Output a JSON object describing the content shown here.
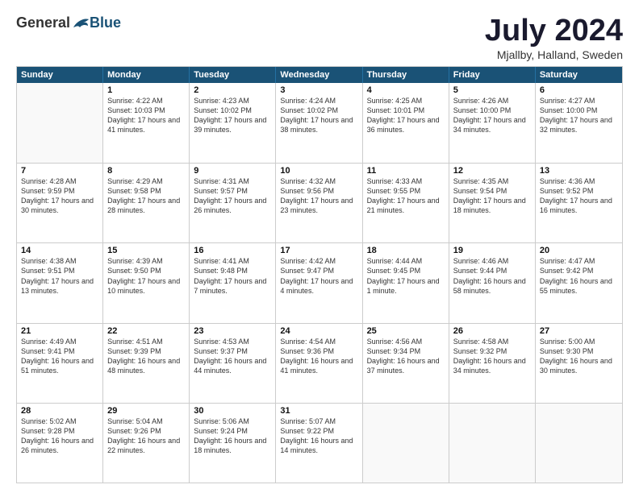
{
  "header": {
    "logo_general": "General",
    "logo_blue": "Blue",
    "month_title": "July 2024",
    "location": "Mjallby, Halland, Sweden"
  },
  "days_of_week": [
    "Sunday",
    "Monday",
    "Tuesday",
    "Wednesday",
    "Thursday",
    "Friday",
    "Saturday"
  ],
  "weeks": [
    [
      {
        "day": "",
        "empty": true
      },
      {
        "day": "1",
        "sunrise": "4:22 AM",
        "sunset": "10:03 PM",
        "daylight": "17 hours and 41 minutes."
      },
      {
        "day": "2",
        "sunrise": "4:23 AM",
        "sunset": "10:02 PM",
        "daylight": "17 hours and 39 minutes."
      },
      {
        "day": "3",
        "sunrise": "4:24 AM",
        "sunset": "10:02 PM",
        "daylight": "17 hours and 38 minutes."
      },
      {
        "day": "4",
        "sunrise": "4:25 AM",
        "sunset": "10:01 PM",
        "daylight": "17 hours and 36 minutes."
      },
      {
        "day": "5",
        "sunrise": "4:26 AM",
        "sunset": "10:00 PM",
        "daylight": "17 hours and 34 minutes."
      },
      {
        "day": "6",
        "sunrise": "4:27 AM",
        "sunset": "10:00 PM",
        "daylight": "17 hours and 32 minutes."
      }
    ],
    [
      {
        "day": "7",
        "sunrise": "4:28 AM",
        "sunset": "9:59 PM",
        "daylight": "17 hours and 30 minutes."
      },
      {
        "day": "8",
        "sunrise": "4:29 AM",
        "sunset": "9:58 PM",
        "daylight": "17 hours and 28 minutes."
      },
      {
        "day": "9",
        "sunrise": "4:31 AM",
        "sunset": "9:57 PM",
        "daylight": "17 hours and 26 minutes."
      },
      {
        "day": "10",
        "sunrise": "4:32 AM",
        "sunset": "9:56 PM",
        "daylight": "17 hours and 23 minutes."
      },
      {
        "day": "11",
        "sunrise": "4:33 AM",
        "sunset": "9:55 PM",
        "daylight": "17 hours and 21 minutes."
      },
      {
        "day": "12",
        "sunrise": "4:35 AM",
        "sunset": "9:54 PM",
        "daylight": "17 hours and 18 minutes."
      },
      {
        "day": "13",
        "sunrise": "4:36 AM",
        "sunset": "9:52 PM",
        "daylight": "17 hours and 16 minutes."
      }
    ],
    [
      {
        "day": "14",
        "sunrise": "4:38 AM",
        "sunset": "9:51 PM",
        "daylight": "17 hours and 13 minutes."
      },
      {
        "day": "15",
        "sunrise": "4:39 AM",
        "sunset": "9:50 PM",
        "daylight": "17 hours and 10 minutes."
      },
      {
        "day": "16",
        "sunrise": "4:41 AM",
        "sunset": "9:48 PM",
        "daylight": "17 hours and 7 minutes."
      },
      {
        "day": "17",
        "sunrise": "4:42 AM",
        "sunset": "9:47 PM",
        "daylight": "17 hours and 4 minutes."
      },
      {
        "day": "18",
        "sunrise": "4:44 AM",
        "sunset": "9:45 PM",
        "daylight": "17 hours and 1 minute."
      },
      {
        "day": "19",
        "sunrise": "4:46 AM",
        "sunset": "9:44 PM",
        "daylight": "16 hours and 58 minutes."
      },
      {
        "day": "20",
        "sunrise": "4:47 AM",
        "sunset": "9:42 PM",
        "daylight": "16 hours and 55 minutes."
      }
    ],
    [
      {
        "day": "21",
        "sunrise": "4:49 AM",
        "sunset": "9:41 PM",
        "daylight": "16 hours and 51 minutes."
      },
      {
        "day": "22",
        "sunrise": "4:51 AM",
        "sunset": "9:39 PM",
        "daylight": "16 hours and 48 minutes."
      },
      {
        "day": "23",
        "sunrise": "4:53 AM",
        "sunset": "9:37 PM",
        "daylight": "16 hours and 44 minutes."
      },
      {
        "day": "24",
        "sunrise": "4:54 AM",
        "sunset": "9:36 PM",
        "daylight": "16 hours and 41 minutes."
      },
      {
        "day": "25",
        "sunrise": "4:56 AM",
        "sunset": "9:34 PM",
        "daylight": "16 hours and 37 minutes."
      },
      {
        "day": "26",
        "sunrise": "4:58 AM",
        "sunset": "9:32 PM",
        "daylight": "16 hours and 34 minutes."
      },
      {
        "day": "27",
        "sunrise": "5:00 AM",
        "sunset": "9:30 PM",
        "daylight": "16 hours and 30 minutes."
      }
    ],
    [
      {
        "day": "28",
        "sunrise": "5:02 AM",
        "sunset": "9:28 PM",
        "daylight": "16 hours and 26 minutes."
      },
      {
        "day": "29",
        "sunrise": "5:04 AM",
        "sunset": "9:26 PM",
        "daylight": "16 hours and 22 minutes."
      },
      {
        "day": "30",
        "sunrise": "5:06 AM",
        "sunset": "9:24 PM",
        "daylight": "16 hours and 18 minutes."
      },
      {
        "day": "31",
        "sunrise": "5:07 AM",
        "sunset": "9:22 PM",
        "daylight": "16 hours and 14 minutes."
      },
      {
        "day": "",
        "empty": true
      },
      {
        "day": "",
        "empty": true
      },
      {
        "day": "",
        "empty": true
      }
    ]
  ]
}
